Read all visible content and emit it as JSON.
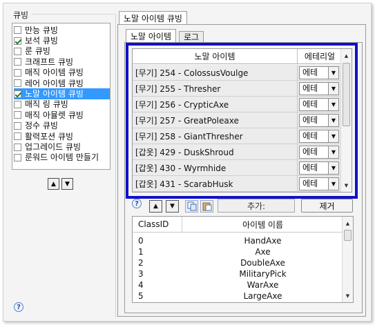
{
  "left_panel": {
    "title": "큐빙",
    "items": [
      {
        "label": "만능 큐빙",
        "checked": false,
        "selected": false
      },
      {
        "label": "보석 큐빙",
        "checked": true,
        "selected": false
      },
      {
        "label": "룬 큐빙",
        "checked": false,
        "selected": false
      },
      {
        "label": "크래프트 큐빙",
        "checked": false,
        "selected": false
      },
      {
        "label": "매직 아이템 큐빙",
        "checked": false,
        "selected": false
      },
      {
        "label": "레어 아이템 큐빙",
        "checked": false,
        "selected": false
      },
      {
        "label": "노말 아이템 큐빙",
        "checked": true,
        "selected": true
      },
      {
        "label": "매직 링 큐빙",
        "checked": false,
        "selected": false
      },
      {
        "label": "매직 아뮬렛 큐빙",
        "checked": false,
        "selected": false
      },
      {
        "label": "정수 큐빙",
        "checked": false,
        "selected": false
      },
      {
        "label": "활력포션 큐빙",
        "checked": false,
        "selected": false
      },
      {
        "label": "업그레이드 큐빙",
        "checked": false,
        "selected": false
      },
      {
        "label": "룬워드 아이템 만들기",
        "checked": false,
        "selected": false
      }
    ],
    "up_arrow": "▲",
    "down_arrow": "▼",
    "help_glyph": "?"
  },
  "right_panel": {
    "outer_tab": "노말 아이템 큐빙",
    "tabs": [
      "노말 아이템",
      "로그"
    ],
    "grid": {
      "col_item": "노말 아이템",
      "col_material": "에테리얼",
      "rows": [
        {
          "item": "[무기] 254 - ColossusVoulge",
          "material": "에테"
        },
        {
          "item": "[무기] 255 - Thresher",
          "material": "에테"
        },
        {
          "item": "[무기] 256 - CrypticAxe",
          "material": "에테"
        },
        {
          "item": "[무기] 257 - GreatPoleaxe",
          "material": "에테"
        },
        {
          "item": "[무기] 258 - GiantThresher",
          "material": "에테"
        },
        {
          "item": "[갑옷] 429 - DuskShroud",
          "material": "에테"
        },
        {
          "item": "[갑옷] 430 - Wyrmhide",
          "material": "에테"
        },
        {
          "item": "[갑옷] 431 - ScarabHusk",
          "material": "에테"
        }
      ]
    },
    "toolbar": {
      "help_glyph": "?",
      "up_arrow": "▲",
      "down_arrow": "▼",
      "add_label": "추가:",
      "remove_label": "제거"
    },
    "class_list": {
      "col_id": "ClassID",
      "col_name": "아이템 이름",
      "rows": [
        {
          "id": "0",
          "name": "HandAxe"
        },
        {
          "id": "1",
          "name": "Axe"
        },
        {
          "id": "2",
          "name": "DoubleAxe"
        },
        {
          "id": "3",
          "name": "MilitaryPick"
        },
        {
          "id": "4",
          "name": "WarAxe"
        },
        {
          "id": "5",
          "name": "LargeAxe"
        }
      ]
    },
    "highlight_color": "#1010c8",
    "selection_color": "#3399ff"
  }
}
